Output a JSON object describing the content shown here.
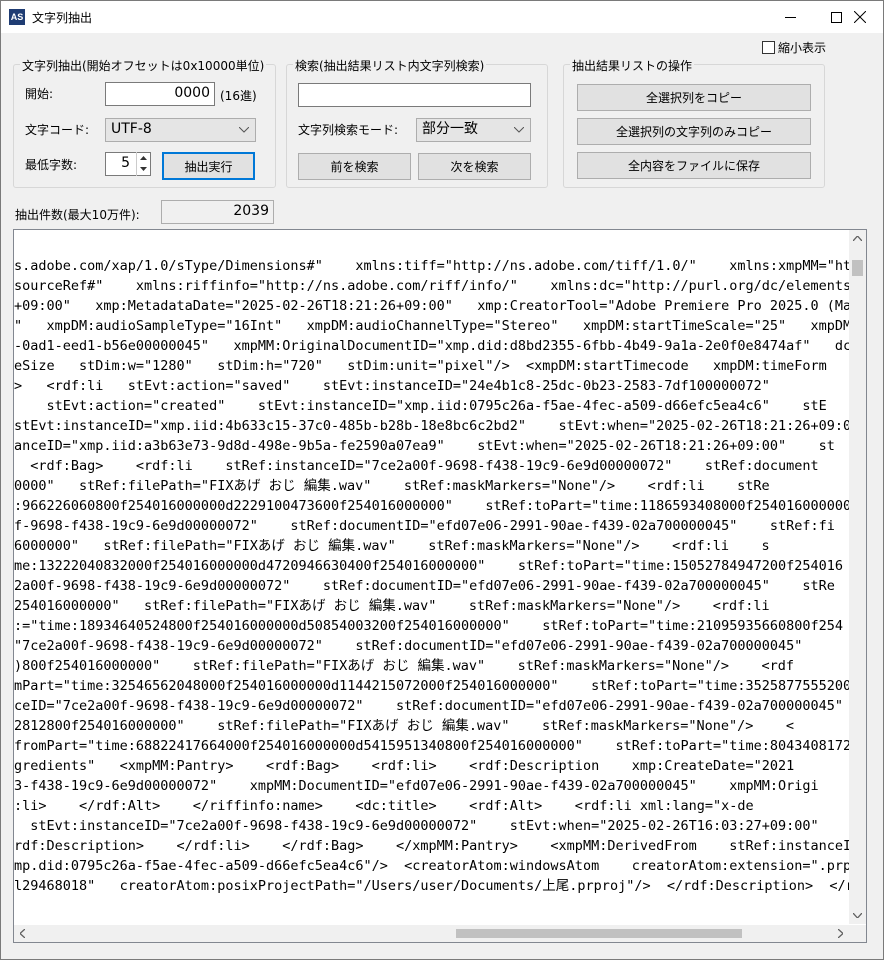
{
  "window": {
    "title": "文字列抽出",
    "app_icon_text": "AS",
    "accent": "#0078d7"
  },
  "compact_view": {
    "label": "縮小表示",
    "checked": false
  },
  "extract_group": {
    "legend": "文字列抽出(開始オフセットは0x10000単位)",
    "start_label": "開始:",
    "start_value": "0000",
    "start_unit": "(16進)",
    "encoding_label": "文字コード:",
    "encoding_value": "UTF-8",
    "min_chars_label": "最低字数:",
    "min_chars_value": "5",
    "run_button": "抽出実行"
  },
  "search_group": {
    "legend": "検索(抽出結果リスト内文字列検索)",
    "search_value": "",
    "mode_label": "文字列検索モード:",
    "mode_value": "部分一致",
    "prev_button": "前を検索",
    "next_button": "次を検索"
  },
  "ops_group": {
    "legend": "抽出結果リストの操作",
    "copy_all": "全選択列をコピー",
    "copy_strings": "全選択列の文字列のみコピー",
    "save_all": "全内容をファイルに保存"
  },
  "count": {
    "label": "抽出件数(最大10万件):",
    "value": "2039"
  },
  "results": {
    "lines": [
      "s.adobe.com/xap/1.0/sType/Dimensions#\"    xmlns:tiff=\"http://ns.adobe.com/tiff/1.0/\"    xmlns:xmpMM=\"http",
      "sourceRef#\"    xmlns:riffinfo=\"http://ns.adobe.com/riff/info/\"    xmlns:dc=\"http://purl.org/dc/elements/1",
      "+09:00\"   xmp:MetadataDate=\"2025-02-26T18:21:26+09:00\"   xmp:CreatorTool=\"Adobe Premiere Pro 2025.0 (Maci",
      "\"   xmpDM:audioSampleType=\"16Int\"   xmpDM:audioChannelType=\"Stereo\"   xmpDM:startTimeScale=\"25\"   xmpDM:s",
      "-0ad1-eed1-b56e00000045\"   xmpMM:OriginalDocumentID=\"xmp.did:d8bd2355-6fbb-4b49-9a1a-2e0f0e8474af\"   dc:f",
      "eSize   stDim:w=\"1280\"   stDim:h=\"720\"   stDim:unit=\"pixel\"/>  <xmpDM:startTimecode   xmpDM:timeForm",
      ">   <rdf:li   stEvt:action=\"saved\"    stEvt:instanceID=\"24e4b1c8-25dc-0b23-2583-7df100000072\"",
      "    stEvt:action=\"created\"    stEvt:instanceID=\"xmp.iid:0795c26a-f5ae-4fec-a509-d66efc5ea4c6\"    stE",
      "stEvt:instanceID=\"xmp.iid:4b633c15-37c0-485b-b28b-18e8bc6c2bd2\"    stEvt:when=\"2025-02-26T18:21:26+09:0",
      "anceID=\"xmp.iid:a3b63e73-9d8d-498e-9b5a-fe2590a07ea9\"    stEvt:when=\"2025-02-26T18:21:26+09:00\"    st",
      "  <rdf:Bag>    <rdf:li    stRef:instanceID=\"7ce2a00f-9698-f438-19c9-6e9d00000072\"    stRef:document",
      "0000\"   stRef:filePath=\"FIXあげ おじ 編集.wav\"    stRef:maskMarkers=\"None\"/>    <rdf:li    stRe",
      ":966226060800f254016000000d2229100473600f254016000000\"    stRef:toPart=\"time:1186593408000f254016000000",
      "f-9698-f438-19c9-6e9d00000072\"    stRef:documentID=\"efd07e06-2991-90ae-f439-02a700000045\"    stRef:fi",
      "6000000\"   stRef:filePath=\"FIXあげ おじ 編集.wav\"    stRef:maskMarkers=\"None\"/>    <rdf:li    s",
      "me:13222040832000f254016000000d4720946630400f254016000000\"    stRef:toPart=\"time:15052784947200f254016",
      "2a00f-9698-f438-19c9-6e9d00000072\"    stRef:documentID=\"efd07e06-2991-90ae-f439-02a700000045\"    stRe",
      "254016000000\"   stRef:filePath=\"FIXあげ おじ 編集.wav\"    stRef:maskMarkers=\"None\"/>    <rdf:li",
      ":=\"time:18934640524800f254016000000d50854003200f254016000000\"    stRef:toPart=\"time:21095935660800f254",
      "\"7ce2a00f-9698-f438-19c9-6e9d00000072\"    stRef:documentID=\"efd07e06-2991-90ae-f439-02a700000045\"",
      ")800f254016000000\"    stRef:filePath=\"FIXあげ おじ 編集.wav\"    stRef:maskMarkers=\"None\"/>    <rdf",
      "mPart=\"time:32546562048000f254016000000d1144215072000f254016000000\"    stRef:toPart=\"time:3525877555200f",
      "ceID=\"7ce2a00f-9698-f438-19c9-6e9d00000072\"    stRef:documentID=\"efd07e06-2991-90ae-f439-02a700000045\"",
      "2812800f254016000000\"    stRef:filePath=\"FIXあげ おじ 編集.wav\"    stRef:maskMarkers=\"None\"/>    <",
      "fromPart=\"time:68822417664000f254016000000d5415951340800f254016000000\"    stRef:toPart=\"time:80434081728",
      "gredients\"   <xmpMM:Pantry>    <rdf:Bag>    <rdf:li>    <rdf:Description    xmp:CreateDate=\"2021",
      "3-f438-19c9-6e9d00000072\"    xmpMM:DocumentID=\"efd07e06-2991-90ae-f439-02a700000045\"    xmpMM:Origi",
      ":li>    </rdf:Alt>    </riffinfo:name>    <dc:title>    <rdf:Alt>    <rdf:li xml:lang=\"x-de",
      "  stEvt:instanceID=\"7ce2a00f-9698-f438-19c9-6e9d00000072\"    stEvt:when=\"2025-02-26T16:03:27+09:00\"",
      "rdf:Description>    </rdf:li>    </rdf:Bag>    </xmpMM:Pantry>    <xmpMM:DerivedFrom    stRef:instanceID=\"",
      "mp.did:0795c26a-f5ae-4fec-a509-d66efc5ea4c6\"/>  <creatorAtom:windowsAtom    creatorAtom:extension=\".prpr",
      "l29468018\"   creatorAtom:posixProjectPath=\"/Users/user/Documents/上尾.prproj\"/>  </rdf:Description>  </rd"
    ]
  }
}
